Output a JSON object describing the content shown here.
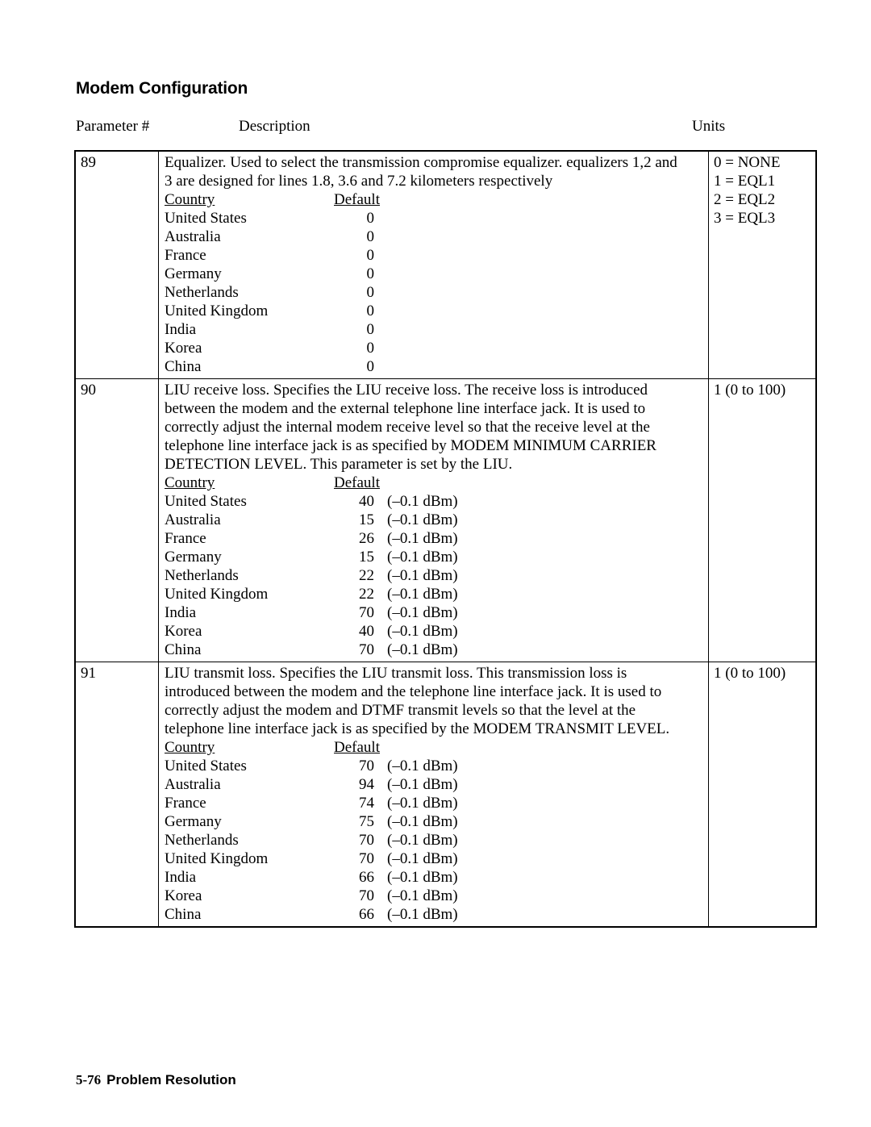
{
  "document": {
    "title": "Modem Configuration",
    "column_headers": {
      "parameter": "Parameter #",
      "description": "Description",
      "units": "Units"
    },
    "footer": {
      "page_number": "5-76",
      "section": "Problem Resolution"
    }
  },
  "table": {
    "sub_headers": {
      "country": "Country",
      "default": "Default"
    },
    "rows": [
      {
        "parameter": "89",
        "description_lines": [
          "Equalizer. Used to select the transmission compromise equalizer. equalizers 1,2 and",
          "3 are designed for lines 1.8, 3.6 and 7.2 kilometers respectively"
        ],
        "defaults": [
          {
            "country": "United States",
            "value": "0",
            "unit": ""
          },
          {
            "country": "Australia",
            "value": "0",
            "unit": ""
          },
          {
            "country": "France",
            "value": "0",
            "unit": ""
          },
          {
            "country": "Germany",
            "value": "0",
            "unit": ""
          },
          {
            "country": "Netherlands",
            "value": "0",
            "unit": ""
          },
          {
            "country": "United Kingdom",
            "value": "0",
            "unit": ""
          },
          {
            "country": "India",
            "value": "0",
            "unit": ""
          },
          {
            "country": "Korea",
            "value": "0",
            "unit": ""
          },
          {
            "country": "China",
            "value": "0",
            "unit": ""
          }
        ],
        "units_lines": [
          "0 = NONE",
          "1 = EQL1",
          "2 = EQL2",
          "3 = EQL3"
        ]
      },
      {
        "parameter": "90",
        "description_lines": [
          "LIU receive loss. Specifies the LIU receive loss. The receive loss is introduced",
          "between the modem and the external telephone line interface jack. It is used to",
          "correctly adjust the internal modem receive level so that the receive level at the",
          "telephone line interface jack is as specified by MODEM MINIMUM CARRIER",
          "DETECTION LEVEL. This parameter is set by the LIU."
        ],
        "defaults": [
          {
            "country": "United States",
            "value": "40",
            "unit": "(–0.1 dBm)"
          },
          {
            "country": "Australia",
            "value": "15",
            "unit": "(–0.1 dBm)"
          },
          {
            "country": "France",
            "value": "26",
            "unit": "(–0.1 dBm)"
          },
          {
            "country": "Germany",
            "value": "15",
            "unit": "(–0.1 dBm)"
          },
          {
            "country": "Netherlands",
            "value": "22",
            "unit": "(–0.1 dBm)"
          },
          {
            "country": "United Kingdom",
            "value": "22",
            "unit": "(–0.1 dBm)"
          },
          {
            "country": "India",
            "value": "70",
            "unit": "(–0.1 dBm)"
          },
          {
            "country": "Korea",
            "value": "40",
            "unit": "(–0.1 dBm)"
          },
          {
            "country": "China",
            "value": "70",
            "unit": "(–0.1 dBm)"
          }
        ],
        "units_lines": [
          "1 (0 to 100)"
        ]
      },
      {
        "parameter": "91",
        "description_lines": [
          "LIU transmit loss. Specifies the LIU transmit loss. This transmission loss is",
          "introduced between the modem and the telephone line interface jack. It is used to",
          "correctly adjust the modem and DTMF transmit levels so that the level at the",
          "telephone line interface jack is as specified by the MODEM TRANSMIT LEVEL."
        ],
        "defaults": [
          {
            "country": "United States",
            "value": "70",
            "unit": "(–0.1 dBm)"
          },
          {
            "country": "Australia",
            "value": "94",
            "unit": "(–0.1 dBm)"
          },
          {
            "country": "France",
            "value": "74",
            "unit": "(–0.1 dBm)"
          },
          {
            "country": "Germany",
            "value": "75",
            "unit": "(–0.1 dBm)"
          },
          {
            "country": "Netherlands",
            "value": "70",
            "unit": "(–0.1 dBm)"
          },
          {
            "country": "United Kingdom",
            "value": "70",
            "unit": "(–0.1 dBm)"
          },
          {
            "country": "India",
            "value": "66",
            "unit": "(–0.1 dBm)"
          },
          {
            "country": "Korea",
            "value": "70",
            "unit": "(–0.1 dBm)"
          },
          {
            "country": "China",
            "value": "66",
            "unit": "(–0.1 dBm)"
          }
        ],
        "units_lines": [
          "1 (0 to 100)"
        ]
      }
    ]
  }
}
